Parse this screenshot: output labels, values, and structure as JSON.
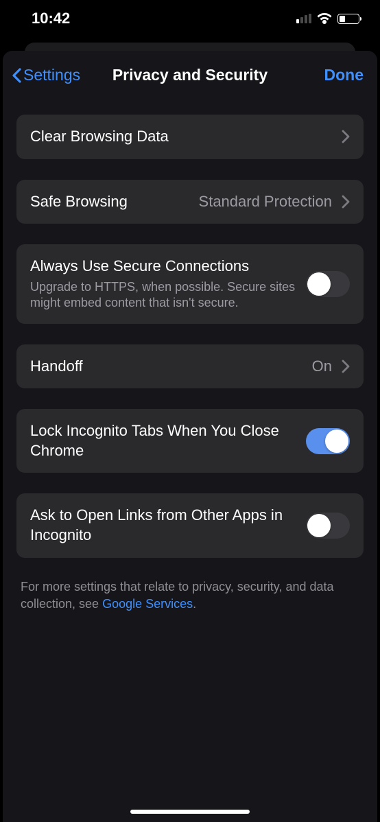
{
  "statusBar": {
    "time": "10:42"
  },
  "nav": {
    "back": "Settings",
    "title": "Privacy and Security",
    "done": "Done"
  },
  "rows": {
    "clearData": {
      "title": "Clear Browsing Data"
    },
    "safeBrowsing": {
      "title": "Safe Browsing",
      "value": "Standard Protection"
    },
    "secureConn": {
      "title": "Always Use Secure Connections",
      "sub": "Upgrade to HTTPS, when possible. Secure sites might embed content that isn't secure.",
      "on": false
    },
    "handoff": {
      "title": "Handoff",
      "value": "On"
    },
    "lockIncognito": {
      "title": "Lock Incognito Tabs When You Close Chrome",
      "on": true
    },
    "askIncognito": {
      "title": "Ask to Open Links from Other Apps in Incognito",
      "on": false
    }
  },
  "footer": {
    "prefix": "For more settings that relate to privacy, security, and data collection, see ",
    "link": "Google Services",
    "suffix": "."
  }
}
